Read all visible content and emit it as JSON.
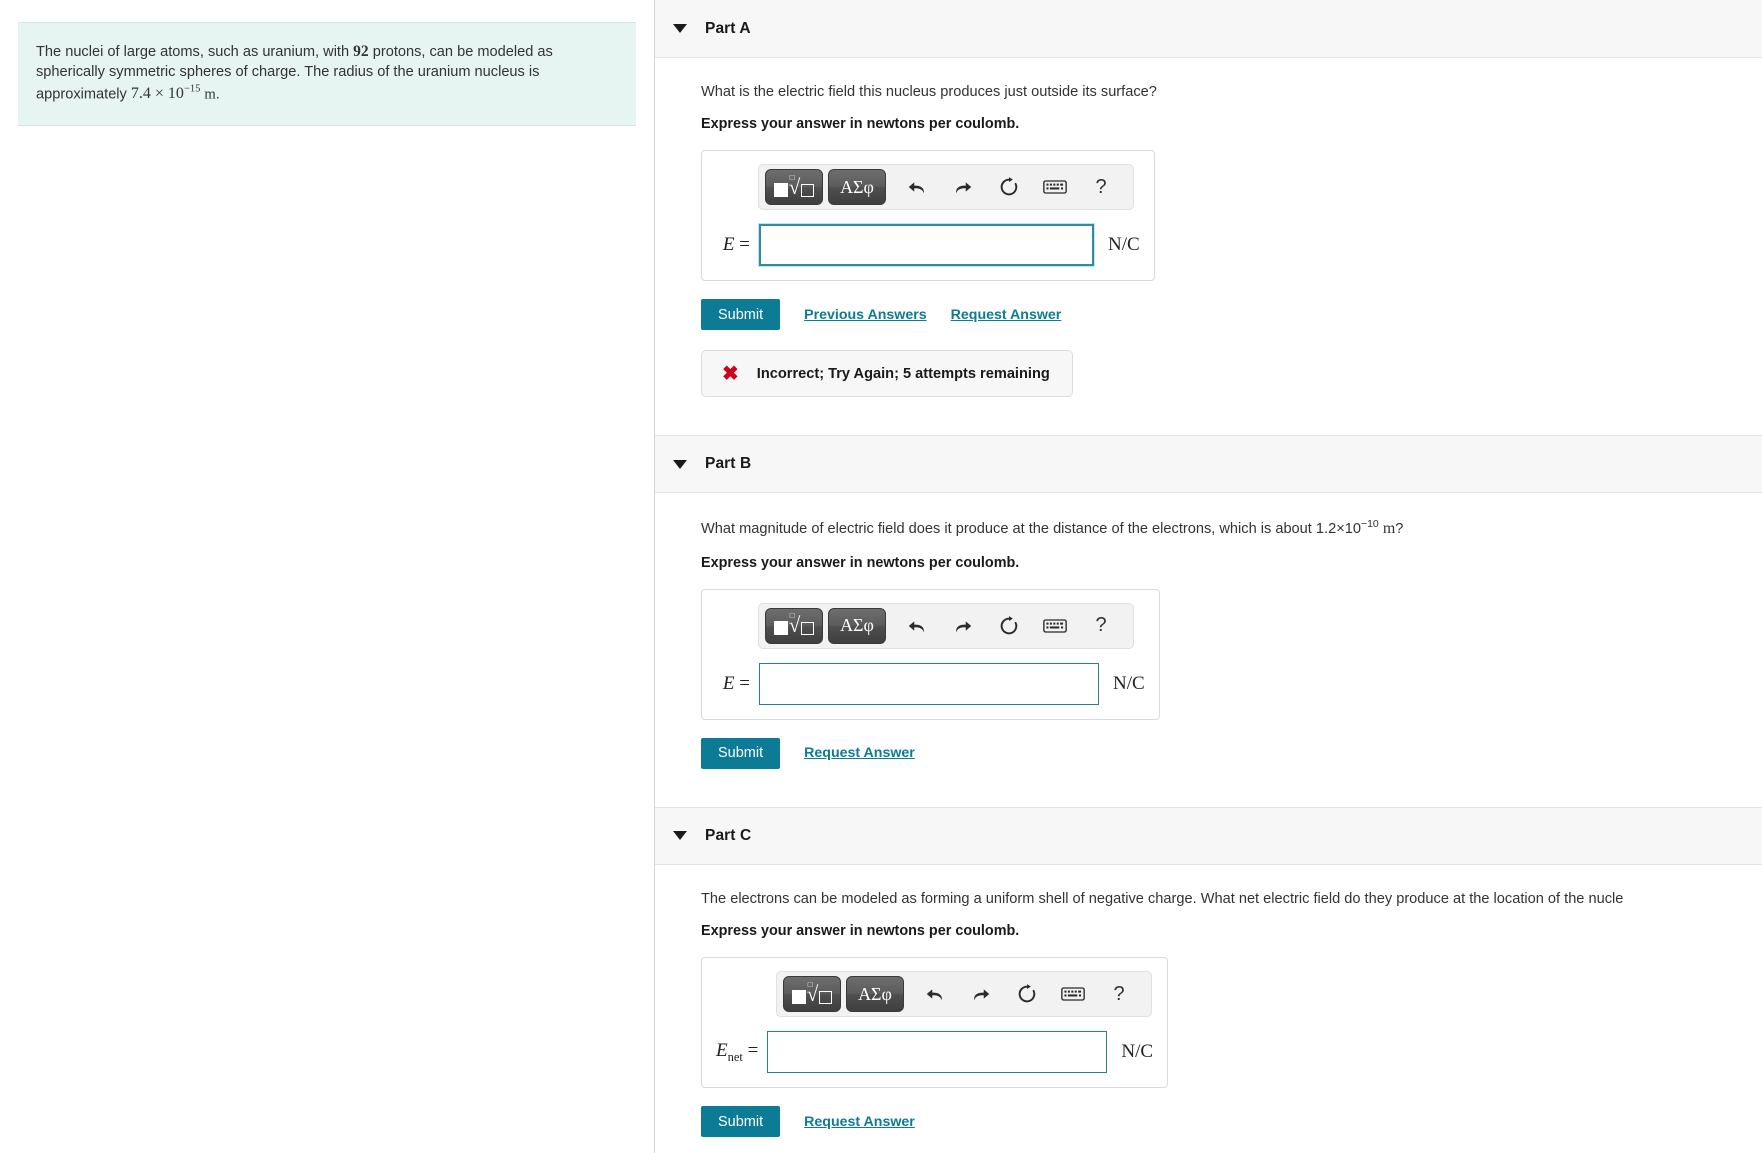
{
  "problem": {
    "text_before_protons": "The nuclei of large atoms, such as uranium, with ",
    "protons_count": "92",
    "text_after_protons": " protons, can be modeled as spherically symmetric spheres of charge. The radius of the uranium nucleus is approximately ",
    "radius_value": "7.4 × 10",
    "radius_exponent": "−15",
    "radius_unit": "m",
    "text_end": "."
  },
  "toolbar": {
    "template_button": "template-picker",
    "greek_button": "ΑΣφ",
    "undo": "undo",
    "redo": "redo",
    "reset": "reset",
    "keyboard": "keyboard",
    "help": "?"
  },
  "parts": [
    {
      "title": "Part A",
      "question": "What is the electric field this nucleus produces just outside its surface?",
      "instruction": "Express your answer in newtons per coulomb.",
      "variable": "E",
      "variable_sub": "",
      "equals": "=",
      "input_value": "",
      "input_placeholder": "",
      "unit": "N/C",
      "submit_label": "Submit",
      "links": [
        "Previous Answers",
        "Request Answer"
      ],
      "feedback": {
        "icon": "x-mark",
        "text": "Incorrect; Try Again; 5 attempts remaining"
      }
    },
    {
      "title": "Part B",
      "question_before": "What magnitude of electric field does it produce at the distance of the electrons, which is about ",
      "question_value": "1.2×10",
      "question_exponent": "−10",
      "question_unit": "m",
      "question_after": "?",
      "instruction": "Express your answer in newtons per coulomb.",
      "variable": "E",
      "variable_sub": "",
      "equals": "=",
      "input_value": "",
      "input_placeholder": "",
      "unit": "N/C",
      "submit_label": "Submit",
      "links": [
        "Request Answer"
      ],
      "feedback": null
    },
    {
      "title": "Part C",
      "question": "The electrons can be modeled as forming a uniform shell of negative charge. What net electric field do they produce at the location of the nucle",
      "instruction": "Express your answer in newtons per coulomb.",
      "variable": "E",
      "variable_sub": "net",
      "equals": "=",
      "input_value": "",
      "input_placeholder": "",
      "unit": "N/C",
      "submit_label": "Submit",
      "links": [
        "Request Answer"
      ],
      "feedback": null
    }
  ],
  "colors": {
    "accent": "#0c7b96",
    "statement_bg": "#e6f4f2",
    "header_bg": "#f7f7f7",
    "error_red": "#d0021b",
    "input_border": "#2b7f93"
  }
}
